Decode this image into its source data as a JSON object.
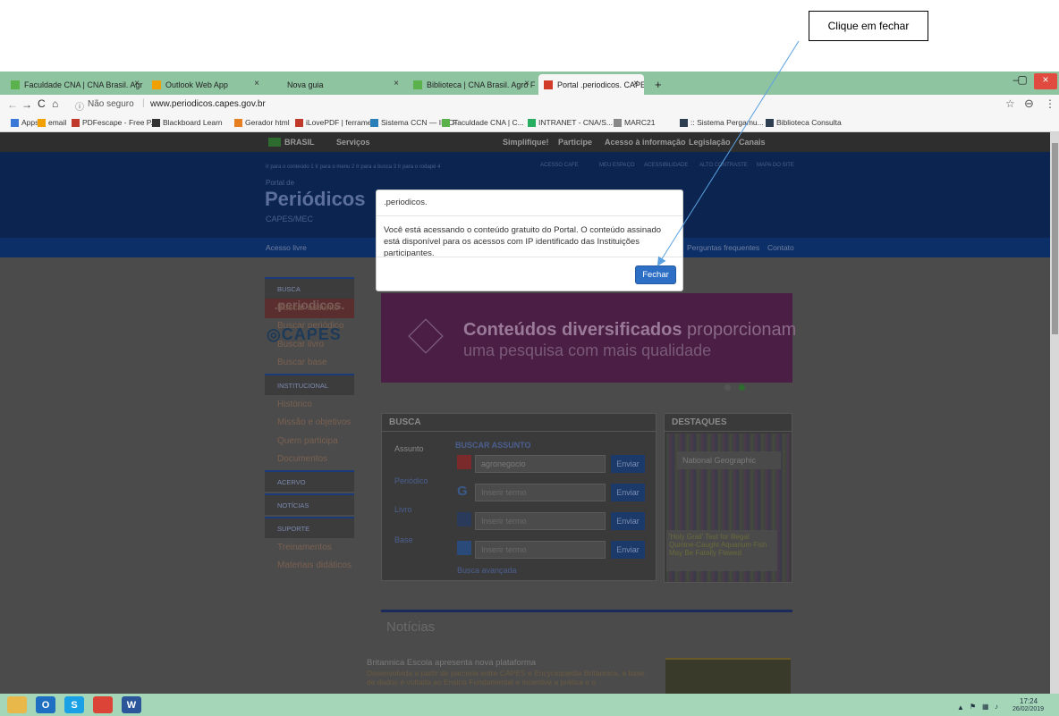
{
  "callout": {
    "text": "Clique em fechar"
  },
  "browser": {
    "tabs": [
      {
        "title": "Faculdade CNA | CNA Brasil. Agr",
        "fav": "#5bb14b"
      },
      {
        "title": "Outlook Web App",
        "fav": "#f0a000"
      },
      {
        "title": "Nova guia",
        "fav": ""
      },
      {
        "title": "Biblioteca | CNA Brasil. Agro Fort",
        "fav": "#5bb14b"
      },
      {
        "title": "Portal .periodicos. CAPES",
        "fav": "#d23b2a"
      }
    ],
    "new_tab": "+",
    "close_glyph": "×",
    "address": {
      "security": "Não seguro",
      "url": "www.periodicos.capes.gov.br"
    },
    "bookmarks": [
      {
        "label": "Apps",
        "color": "#3c78d8"
      },
      {
        "label": "email",
        "color": "#f0a000"
      },
      {
        "label": "PDFescape - Free P...",
        "color": "#c0392b"
      },
      {
        "label": "Blackboard Learn",
        "color": "#333333"
      },
      {
        "label": "Gerador html",
        "color": "#e67e22"
      },
      {
        "label": "iLovePDF | ferrame...",
        "color": "#c0392b"
      },
      {
        "label": "Sistema CCN — IBICT",
        "color": "#2980b9"
      },
      {
        "label": "Faculdade CNA | C...",
        "color": "#5bb14b"
      },
      {
        "label": "INTRANET - CNA/S...",
        "color": "#27ae60"
      },
      {
        "label": "MARC21",
        "color": "#888888"
      },
      {
        "label": ":: Sistema Pergamu...",
        "color": "#2c3e50"
      },
      {
        "label": "Biblioteca Consulta",
        "color": "#2c3e50"
      }
    ]
  },
  "page": {
    "govbar": {
      "brasil": "BRASIL",
      "servicos": "Serviços",
      "links": [
        "Simplifique!",
        "Participe",
        "Acesso à informação",
        "Legislação",
        "Canais"
      ]
    },
    "header": {
      "access_links": "Ir para o conteúdo  1   Ir para o menu  2   Ir para a busca  3   Ir para o rodapé  4",
      "top_links": [
        "ACESSO CAFE",
        "MEU ESPAÇO",
        "ACESSIBILIDADE",
        "ALTO CONTRASTE",
        "MAPA DO SITE"
      ],
      "portal_de": "Portal de",
      "title": "Periódicos",
      "subtitle": "CAPES/MEC"
    },
    "menu": {
      "left": "Acesso livre",
      "right": [
        "Perguntas frequentes",
        "Contato"
      ]
    },
    "logos": {
      "periodicos": ".periodicos.",
      "capes": "CAPES"
    },
    "sidebar": [
      {
        "type": "head",
        "label": "BUSCA"
      },
      {
        "type": "item",
        "label": "Buscar assunto"
      },
      {
        "type": "item",
        "label": "Buscar periódico"
      },
      {
        "type": "item",
        "label": "Buscar livro"
      },
      {
        "type": "item",
        "label": "Buscar base"
      },
      {
        "type": "head",
        "label": "INSTITUCIONAL"
      },
      {
        "type": "item",
        "label": "Histórico"
      },
      {
        "type": "item",
        "label": "Missão e objetivos"
      },
      {
        "type": "item",
        "label": "Quem participa"
      },
      {
        "type": "item",
        "label": "Documentos"
      },
      {
        "type": "head",
        "label": "ACERVO"
      },
      {
        "type": "head",
        "label": "NOTÍCIAS"
      },
      {
        "type": "head",
        "label": "SUPORTE"
      },
      {
        "type": "item",
        "label": "Treinamentos"
      },
      {
        "type": "item",
        "label": "Materiais didáticos"
      }
    ],
    "banner": {
      "strong": "Conteúdos diversificados",
      "rest1": " proporcionam",
      "line2": "uma pesquisa com mais qualidade"
    },
    "busca": {
      "title": "BUSCA",
      "tabs": [
        "Assunto",
        "Periódico",
        "Livro",
        "Base"
      ],
      "section": "BUSCAR ASSUNTO",
      "inputs": [
        {
          "value": "agronegocio",
          "placeholder": ""
        },
        {
          "value": "",
          "placeholder": "Inserir termo"
        },
        {
          "value": "",
          "placeholder": "Inserir termo"
        },
        {
          "value": "",
          "placeholder": "Inserir termo"
        }
      ],
      "send": "Enviar",
      "advanced": "Busca avançada"
    },
    "destaques": {
      "title": "DESTAQUES",
      "ng": "National Geographic",
      "headline": "'Holy Grail' Test for Illegal Quinine-Caught Aquarium Fish May Be Fatally Flawed"
    },
    "noticias": {
      "title": "Notícias",
      "headline": "Britannica Escola apresenta nova plataforma",
      "body": "Desenvolvida a partir de parceria entre CAPES e Encyclopædia Britannica, a base de dados é voltada ao Ensino Fundamental e incentiva a prática e o"
    }
  },
  "modal": {
    "title": ".periodicos.",
    "body": "Você está acessando o conteúdo gratuito do Portal. O conteúdo assinado está disponível para os acessos com IP identificado das Instituições participantes.",
    "button": "Fechar"
  },
  "taskbar": {
    "apps": [
      {
        "name": "explorer",
        "glyph": "",
        "color": "#e8b84a"
      },
      {
        "name": "outlook",
        "glyph": "O",
        "color": "#1e6fc2"
      },
      {
        "name": "skype",
        "glyph": "S",
        "color": "#1aa0e4"
      },
      {
        "name": "chrome",
        "glyph": "",
        "color": "#db4437"
      },
      {
        "name": "word",
        "glyph": "W",
        "color": "#2b579a"
      }
    ],
    "time": "17:24",
    "date": "26/02/2019"
  }
}
